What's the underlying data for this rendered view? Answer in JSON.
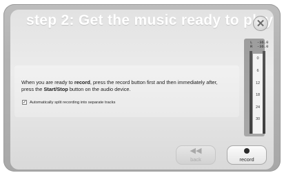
{
  "header": {
    "title": "step 2: Get the music ready to play"
  },
  "instructions": {
    "part1": "When you are ready to ",
    "record_word": "record",
    "part2": ", press the record button first and then immediately after, press the ",
    "startstop_word": "Start/Stop",
    "part3": " button on the audio device."
  },
  "options": {
    "split_tracks_label": "Automatically split recording into separate tracks",
    "split_tracks_checked": true
  },
  "meter": {
    "readout": "L  -36.0\nR  -36.0",
    "ticks": [
      "0",
      "6",
      "12",
      "18",
      "24",
      "30"
    ]
  },
  "buttons": {
    "back_label": "back",
    "record_label": "record"
  }
}
